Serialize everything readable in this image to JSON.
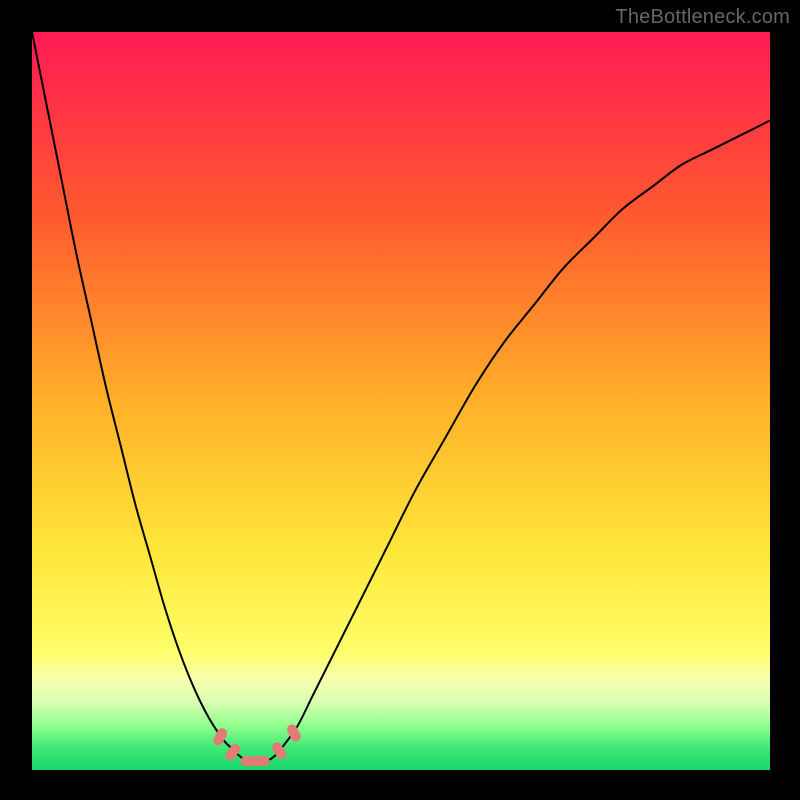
{
  "watermark": "TheBottleneck.com",
  "chart_data": {
    "type": "line",
    "title": "",
    "xlabel": "",
    "ylabel": "",
    "xlim": [
      0,
      100
    ],
    "ylim": [
      0,
      100
    ],
    "gradient_stops": [
      {
        "offset": 0,
        "color": "#ff1a54"
      },
      {
        "offset": 25,
        "color": "#ff5a2e"
      },
      {
        "offset": 50,
        "color": "#ffb029"
      },
      {
        "offset": 70,
        "color": "#ffe63a"
      },
      {
        "offset": 84,
        "color": "#ffff6a"
      },
      {
        "offset": 88,
        "color": "#f6ffb0"
      },
      {
        "offset": 91,
        "color": "#d7ffb0"
      },
      {
        "offset": 94,
        "color": "#8fff8f"
      },
      {
        "offset": 97,
        "color": "#40e876"
      },
      {
        "offset": 100,
        "color": "#17d66a"
      }
    ],
    "series": [
      {
        "name": "bottleneck-curve",
        "x": [
          0,
          2,
          4,
          6,
          8,
          10,
          12,
          14,
          16,
          18,
          20,
          22,
          24,
          26,
          27,
          28,
          29,
          30,
          31,
          32,
          33,
          34,
          36,
          38,
          40,
          44,
          48,
          52,
          56,
          60,
          64,
          68,
          72,
          76,
          80,
          84,
          88,
          92,
          96,
          100
        ],
        "values": [
          100,
          90,
          80,
          70,
          61,
          52,
          44,
          36,
          29,
          22,
          16,
          11,
          7,
          4,
          3,
          2,
          1.3,
          1,
          1,
          1.3,
          2,
          3.2,
          6,
          10,
          14,
          22,
          30,
          38,
          45,
          52,
          58,
          63,
          68,
          72,
          76,
          79,
          82,
          84,
          86,
          88
        ]
      }
    ],
    "markers": {
      "name": "highlight-pills",
      "color": "#e27b74",
      "points": [
        {
          "x": 25.5,
          "y": 4.5,
          "angle": -62
        },
        {
          "x": 27.2,
          "y": 2.4,
          "angle": -55
        },
        {
          "x": 29.5,
          "y": 1.2,
          "angle": 0
        },
        {
          "x": 31.0,
          "y": 1.2,
          "angle": 0
        },
        {
          "x": 33.5,
          "y": 2.6,
          "angle": 58
        },
        {
          "x": 35.5,
          "y": 5.0,
          "angle": 62
        }
      ]
    }
  }
}
